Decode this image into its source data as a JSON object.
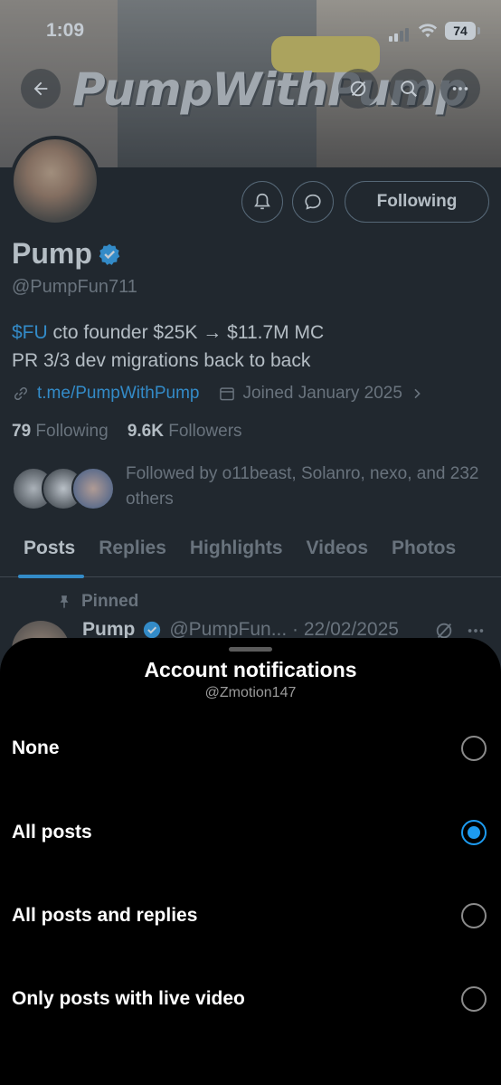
{
  "status_bar": {
    "time": "1:09",
    "battery": "74"
  },
  "banner": {
    "logo_text": "PumpWithPump"
  },
  "profile": {
    "follow_button": "Following",
    "name": "Pump",
    "handle": "@PumpFun711",
    "bio_ticker": "$FU",
    "bio_line1": " cto founder $25K → $11.7M MC",
    "bio_line2": "PR 3/3 dev migrations back to back",
    "link": "t.me/PumpWithPump",
    "joined": "Joined January 2025",
    "following_count": "79",
    "following_label": "Following",
    "followers_count": "9.6K",
    "followers_label": "Followers",
    "followed_by": "Followed by o11beast, Solanro, nexo, and 232 others"
  },
  "tabs": [
    "Posts",
    "Replies",
    "Highlights",
    "Videos",
    "Photos"
  ],
  "pinned_post": {
    "pinned_label": "Pinned",
    "author": "Pump",
    "handle_date": "@PumpFun... · 22/02/2025"
  },
  "sheet": {
    "title": "Account notifications",
    "subtitle": "@Zmotion147",
    "options": [
      {
        "label": "None",
        "selected": false
      },
      {
        "label": "All posts",
        "selected": true
      },
      {
        "label": "All posts and replies",
        "selected": false
      },
      {
        "label": "Only posts with live video",
        "selected": false
      }
    ]
  },
  "colors": {
    "accent": "#1d9bf0",
    "background": "#000000",
    "muted": "#71767b"
  }
}
